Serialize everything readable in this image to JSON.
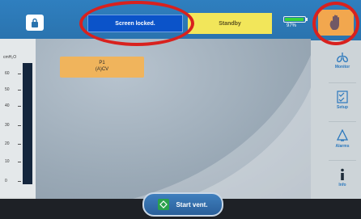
{
  "topbar": {
    "lock_icon": "lock-icon",
    "locked_message": "Screen locked.",
    "standby_label": "Standby",
    "battery_percent": "97%",
    "battery_level": 0.97,
    "hand_icon": "hand-icon"
  },
  "scale": {
    "unit": "cmH₂O",
    "ticks": [
      "60",
      "50",
      "40",
      "30",
      "20",
      "10",
      "0"
    ]
  },
  "mode": {
    "line1": "P1",
    "line2": "(A)CV"
  },
  "sidebar": {
    "items": [
      {
        "label": "Monitor",
        "icon": "lungs-icon"
      },
      {
        "label": "Setup",
        "icon": "checklist-icon"
      },
      {
        "label": "Alarms",
        "icon": "bell-icon"
      },
      {
        "label": "Info",
        "icon": "info-icon"
      }
    ]
  },
  "bottom": {
    "start_label": "Start vent."
  },
  "colors": {
    "accent": "#0b53c9",
    "standby": "#f2e65a",
    "mode_tile": "#f0b45c",
    "annotation": "#d8211e"
  }
}
